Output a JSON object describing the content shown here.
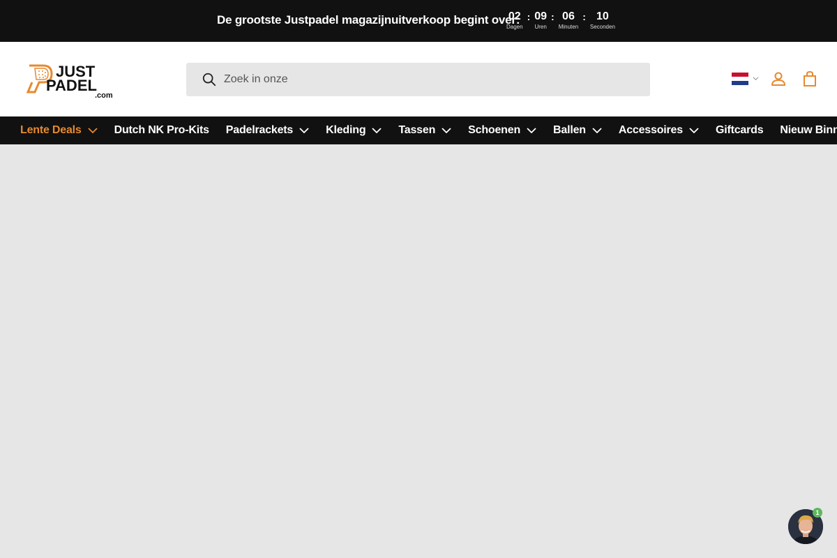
{
  "announcement": {
    "text": "De grootste Justpadel magazijnuitverkoop begint over:",
    "countdown": [
      {
        "value": "02",
        "label": "Dagen"
      },
      {
        "value": "09",
        "label": "Uren"
      },
      {
        "value": "06",
        "label": "Minuten"
      },
      {
        "value": "10",
        "label": "Seconden"
      }
    ],
    "separator": ":"
  },
  "header": {
    "logo": {
      "line1": "JUST",
      "line2": "PADEL",
      "line3": ".com"
    },
    "search": {
      "placeholder": "Zoek in onze"
    },
    "icons": {
      "search": "search-icon",
      "flag": "netherlands-flag-icon",
      "account": "account-icon",
      "cart": "shopping-bag-icon"
    }
  },
  "nav": {
    "items": [
      {
        "label": "Lente Deals",
        "dropdown": true,
        "active": true
      },
      {
        "label": "Dutch NK Pro-Kits",
        "dropdown": false
      },
      {
        "label": "Padelrackets",
        "dropdown": true
      },
      {
        "label": "Kleding",
        "dropdown": true
      },
      {
        "label": "Tassen",
        "dropdown": true
      },
      {
        "label": "Schoenen",
        "dropdown": true
      },
      {
        "label": "Ballen",
        "dropdown": true
      },
      {
        "label": "Accessoires",
        "dropdown": true
      },
      {
        "label": "Giftcards",
        "dropdown": false
      },
      {
        "label": "Nieuw Binnen",
        "dropdown": false
      }
    ]
  },
  "chat": {
    "badge_count": "1"
  },
  "colors": {
    "accent": "#e7892f",
    "dark": "#111111",
    "background": "#e6e6e6"
  }
}
